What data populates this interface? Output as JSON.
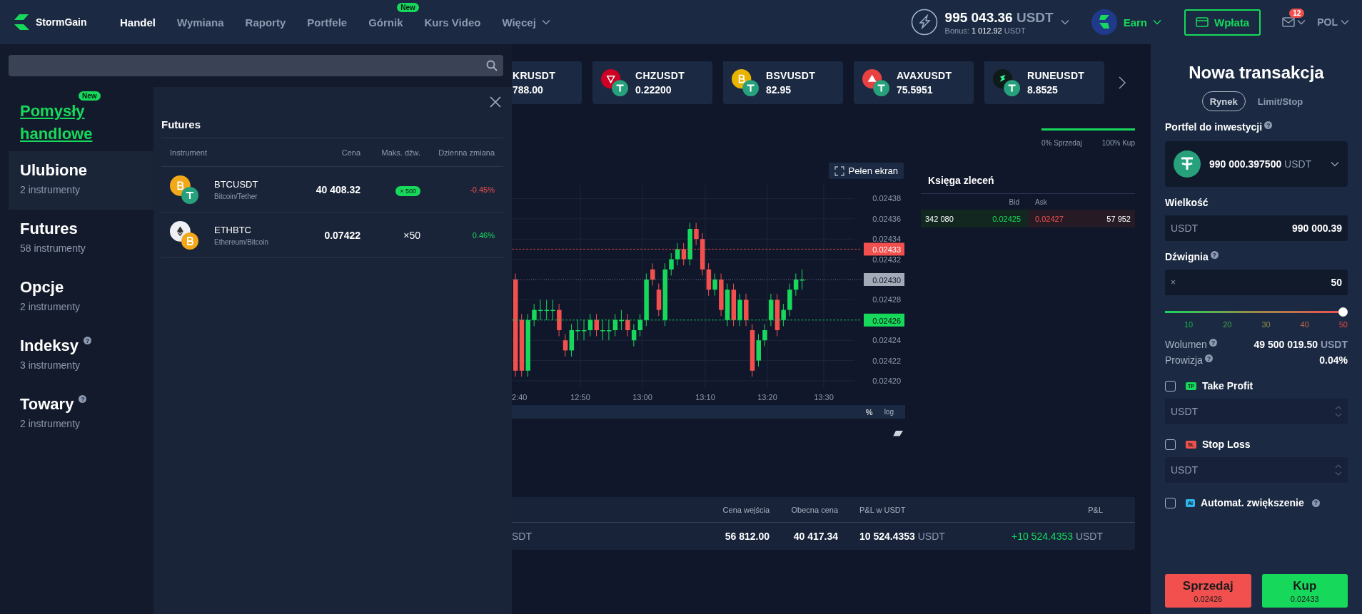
{
  "header": {
    "logo": "StormGain",
    "nav": [
      {
        "label": "Handel",
        "selected": true
      },
      {
        "label": "Wymiana",
        "selected": false
      },
      {
        "label": "Raporty",
        "selected": false
      },
      {
        "label": "Portfele",
        "selected": false
      },
      {
        "label": "Górnik",
        "selected": false,
        "badge": "New"
      },
      {
        "label": "Kurs Video",
        "selected": false
      },
      {
        "label": "Więcej",
        "selected": false,
        "dropdown": true
      }
    ],
    "balance": {
      "amount": "995 043.36",
      "currency": "USDT",
      "bonus_label": "Bonus:",
      "bonus_amount": "1 012.92",
      "bonus_currency": "USDT"
    },
    "earn": "Earn",
    "deposit_button": "Wpłata",
    "mail_badge": "12",
    "language": "POL"
  },
  "instrument_panel": {
    "ideas": {
      "label": "Pomysły handlowe",
      "badge": "New"
    },
    "categories": [
      {
        "title": "Ulubione",
        "count": "2 instrumenty",
        "selected": true
      },
      {
        "title": "Futures",
        "count": "58 instrumenty",
        "selected": false
      },
      {
        "title": "Opcje",
        "count": "2 instrumenty",
        "selected": false
      },
      {
        "title": "Indeksy",
        "count": "3 instrumenty",
        "selected": false,
        "hint": "?"
      },
      {
        "title": "Towary",
        "count": "2 instrumenty",
        "selected": false,
        "hint": "?"
      }
    ],
    "list": {
      "title": "Futures",
      "columns": [
        "Instrument",
        "Cena",
        "Maks. dźw.",
        "Dzienna zmiana"
      ],
      "rows": [
        {
          "symbol": "BTCUSDT",
          "name": "Bitcoin/Tether",
          "icon": {
            "kind": "btc"
          },
          "quote_icon": {
            "kind": "usdt"
          },
          "price": "40 408.32",
          "leverage": {
            "kind": "badge",
            "text": "× 500"
          },
          "change": {
            "kind": "down",
            "text": "-0.45%"
          }
        },
        {
          "symbol": "ETHBTC",
          "name": "Ethereum/Bitcoin",
          "icon": {
            "kind": "eth"
          },
          "quote_icon": {
            "kind": "btc"
          },
          "price": "0.07422",
          "leverage": {
            "kind": "plain",
            "text": "×50"
          },
          "change": {
            "kind": "up",
            "text": "0.46%"
          }
        }
      ]
    }
  },
  "tickers": [
    {
      "kind": "partial",
      "symbol": "KRUSDT",
      "price": "788.00"
    },
    {
      "kind": "full",
      "symbol": "CHZUSDT",
      "price": "0.22200",
      "icon": {
        "kind": "chz"
      }
    },
    {
      "kind": "full",
      "symbol": "BSVUSDT",
      "price": "82.95",
      "icon": {
        "kind": "bsv"
      }
    },
    {
      "kind": "full",
      "symbol": "AVAXUSDT",
      "price": "75.5951",
      "icon": {
        "kind": "avax"
      }
    },
    {
      "kind": "full",
      "symbol": "RUNEUSDT",
      "price": "8.8525",
      "icon": {
        "kind": "rune"
      }
    }
  ],
  "sentiment": {
    "level": 1,
    "sell_label": "0% Sprzedaj",
    "buy_label": "100% Kup"
  },
  "chart": {
    "fullscreen_button": "Pełen ekran",
    "y_labels": [
      "0.02438",
      "0.02436",
      "0.02434",
      "0.02432",
      "0.02428",
      "0.02424",
      "0.02422",
      "0.02420"
    ],
    "x_labels": [
      "2:40",
      "12:50",
      "13:00",
      "13:10",
      "13:20",
      "13:30"
    ],
    "price_tags": [
      {
        "value": "0.02433",
        "kind": "ask"
      },
      {
        "value": "0.02430",
        "kind": "last"
      },
      {
        "value": "0.02426",
        "kind": "bid"
      }
    ],
    "percent_button": "%",
    "log_button": "log"
  },
  "order_book": {
    "title": "Księga zleceń",
    "bid_header": "Bid",
    "ask_header": "Ask",
    "rows": [
      {
        "bid_size": "342 080",
        "bid": "0.02425",
        "ask": "0.02427",
        "ask_size": "57 952"
      }
    ]
  },
  "positions": {
    "columns": [
      "Cena wejścia",
      "Obecna cena",
      "P&L w USDT",
      "P&L"
    ],
    "rows": [
      {
        "instrument": "SDT",
        "entry": "56 812.00",
        "current": "40 417.34",
        "pl_value": "10 524.4353",
        "pl_unit": "USDT",
        "pnl": {
          "kind": "up",
          "text": "+10 524.4353",
          "unit": "USDT"
        }
      }
    ]
  },
  "trade": {
    "title": "Nowa transakcja",
    "tabs": [
      {
        "label": "Rynek",
        "selected": true
      },
      {
        "label": "Limit/Stop",
        "selected": false
      }
    ],
    "wallet_label": "Portfel do inwestycji",
    "wallet_hint": "?",
    "wallet": {
      "amount": "990 000.397500",
      "currency": "USDT"
    },
    "size_label": "Wielkość",
    "size": {
      "unit": "USDT",
      "value": "990 000.39"
    },
    "leverage_label": "Dźwignia",
    "leverage_hint": "?",
    "leverage": {
      "prefix": "×",
      "value": "50"
    },
    "leverage_slider": {
      "level": 1,
      "ticks": [
        "10",
        "20",
        "30",
        "40",
        "50"
      ]
    },
    "volume": {
      "label": "Wolumen",
      "hint": "?",
      "value": "49 500 019.50",
      "unit": "USDT"
    },
    "fee": {
      "label": "Prowizja",
      "hint": "?",
      "value": "0.04%"
    },
    "options": [
      {
        "kind": "tp",
        "tag": "TP",
        "label": "Take Profit",
        "checked": false,
        "placeholder": "USDT"
      },
      {
        "kind": "sl",
        "tag": "SL",
        "label": "Stop Loss",
        "checked": false,
        "placeholder": "USDT"
      },
      {
        "kind": "auto",
        "tag": "AI",
        "label": "Automat. zwiększenie",
        "checked": false,
        "hint": "?"
      }
    ],
    "sell": {
      "label": "Sprzedaj",
      "price": "0.02426"
    },
    "buy": {
      "label": "Kup",
      "price": "0.02433"
    }
  }
}
